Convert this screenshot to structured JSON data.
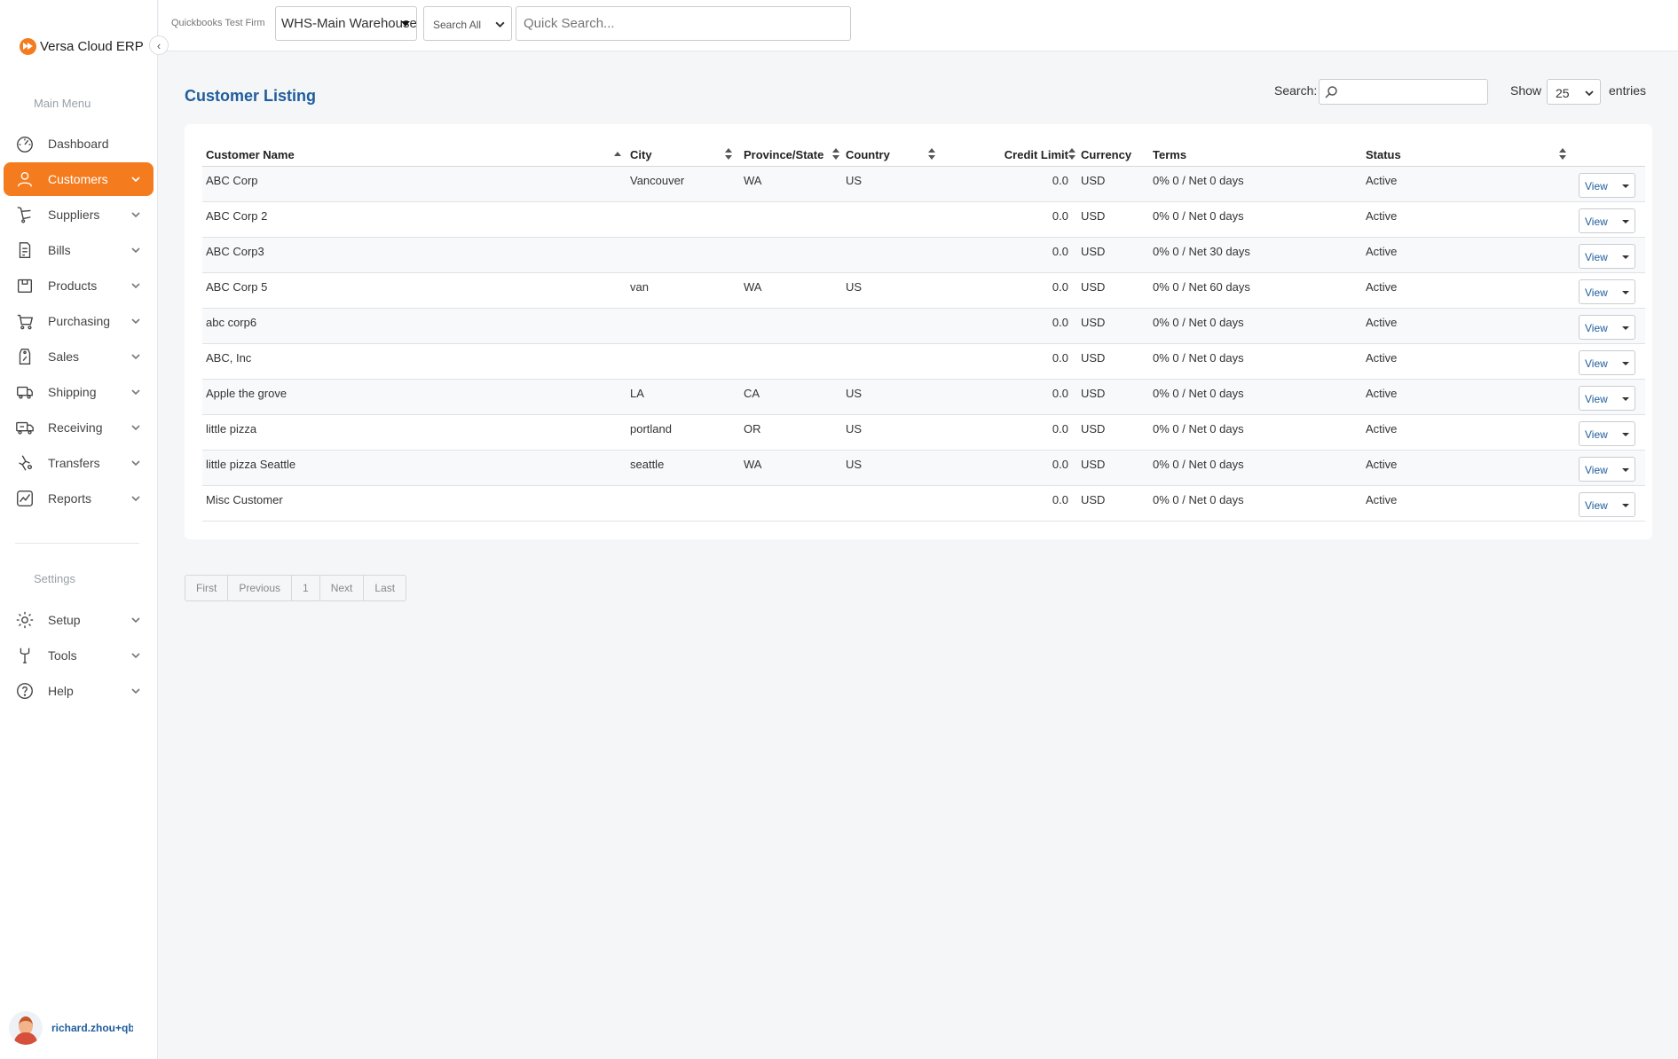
{
  "app": {
    "logo_text": "Versa Cloud ERP",
    "accent_color": "#f47c1f",
    "title_color": "#1f5d9c"
  },
  "sidebar": {
    "main_menu_heading": "Main Menu",
    "settings_heading": "Settings",
    "items": [
      {
        "label": "Dashboard",
        "icon": "dashboard-icon",
        "has_chevron": false,
        "active": false
      },
      {
        "label": "Customers",
        "icon": "person-icon",
        "has_chevron": true,
        "active": true
      },
      {
        "label": "Suppliers",
        "icon": "cart-icon",
        "has_chevron": true,
        "active": false
      },
      {
        "label": "Bills",
        "icon": "bill-icon",
        "has_chevron": true,
        "active": false
      },
      {
        "label": "Products",
        "icon": "box-icon",
        "has_chevron": true,
        "active": false
      },
      {
        "label": "Purchasing",
        "icon": "basket-icon",
        "has_chevron": true,
        "active": false
      },
      {
        "label": "Sales",
        "icon": "price-tag-icon",
        "has_chevron": true,
        "active": false
      },
      {
        "label": "Shipping",
        "icon": "shipping-icon",
        "has_chevron": true,
        "active": false
      },
      {
        "label": "Receiving",
        "icon": "truck-icon",
        "has_chevron": true,
        "active": false
      },
      {
        "label": "Transfers",
        "icon": "transfer-icon",
        "has_chevron": true,
        "active": false
      },
      {
        "label": "Reports",
        "icon": "chart-icon",
        "has_chevron": true,
        "active": false
      }
    ],
    "settings_items": [
      {
        "label": "Setup",
        "icon": "gear-icon",
        "has_chevron": true
      },
      {
        "label": "Tools",
        "icon": "wrench-icon",
        "has_chevron": true
      },
      {
        "label": "Help",
        "icon": "help-icon",
        "has_chevron": true
      }
    ],
    "user_name": "richard.zhou+qbt"
  },
  "topbar": {
    "firm_name": "Quickbooks Test Firm",
    "warehouse": "WHS-Main Warehouse",
    "search_scope": "Search All",
    "quick_search_placeholder": "Quick Search..."
  },
  "main": {
    "title": "Customer Listing",
    "search_label": "Search:",
    "search_value": "",
    "show_label": "Show",
    "entries_per_page": "25",
    "entries_label": "entries"
  },
  "table": {
    "columns": [
      "Customer Name",
      "City",
      "Province/State",
      "Country",
      "Credit Limit",
      "Currency",
      "Terms",
      "Status"
    ],
    "action_label": "View",
    "rows": [
      {
        "name": "ABC Corp",
        "city": "Vancouver",
        "province": "WA",
        "country": "US",
        "credit_limit": "0.0",
        "currency": "USD",
        "terms": "0% 0 / Net 0 days",
        "status": "Active"
      },
      {
        "name": "ABC Corp 2",
        "city": "",
        "province": "",
        "country": "",
        "credit_limit": "0.0",
        "currency": "USD",
        "terms": "0% 0 / Net 0 days",
        "status": "Active"
      },
      {
        "name": "ABC Corp3",
        "city": "",
        "province": "",
        "country": "",
        "credit_limit": "0.0",
        "currency": "USD",
        "terms": "0% 0 / Net 30 days",
        "status": "Active"
      },
      {
        "name": "ABC Corp 5",
        "city": "van",
        "province": "WA",
        "country": "US",
        "credit_limit": "0.0",
        "currency": "USD",
        "terms": "0% 0 / Net 60 days",
        "status": "Active"
      },
      {
        "name": "abc corp6",
        "city": "",
        "province": "",
        "country": "",
        "credit_limit": "0.0",
        "currency": "USD",
        "terms": "0% 0 / Net 0 days",
        "status": "Active"
      },
      {
        "name": "ABC, Inc",
        "city": "",
        "province": "",
        "country": "",
        "credit_limit": "0.0",
        "currency": "USD",
        "terms": "0% 0 / Net 0 days",
        "status": "Active"
      },
      {
        "name": "Apple the grove",
        "city": "LA",
        "province": "CA",
        "country": "US",
        "credit_limit": "0.0",
        "currency": "USD",
        "terms": "0% 0 / Net 0 days",
        "status": "Active"
      },
      {
        "name": "little pizza",
        "city": "portland",
        "province": "OR",
        "country": "US",
        "credit_limit": "0.0",
        "currency": "USD",
        "terms": "0% 0 / Net 0 days",
        "status": "Active"
      },
      {
        "name": "little pizza Seattle",
        "city": "seattle",
        "province": "WA",
        "country": "US",
        "credit_limit": "0.0",
        "currency": "USD",
        "terms": "0% 0 / Net 0 days",
        "status": "Active"
      },
      {
        "name": "Misc Customer",
        "city": "",
        "province": "",
        "country": "",
        "credit_limit": "0.0",
        "currency": "USD",
        "terms": "0% 0 / Net 0 days",
        "status": "Active"
      }
    ]
  },
  "pagination": {
    "first": "First",
    "previous": "Previous",
    "current_page": "1",
    "next": "Next",
    "last": "Last"
  }
}
